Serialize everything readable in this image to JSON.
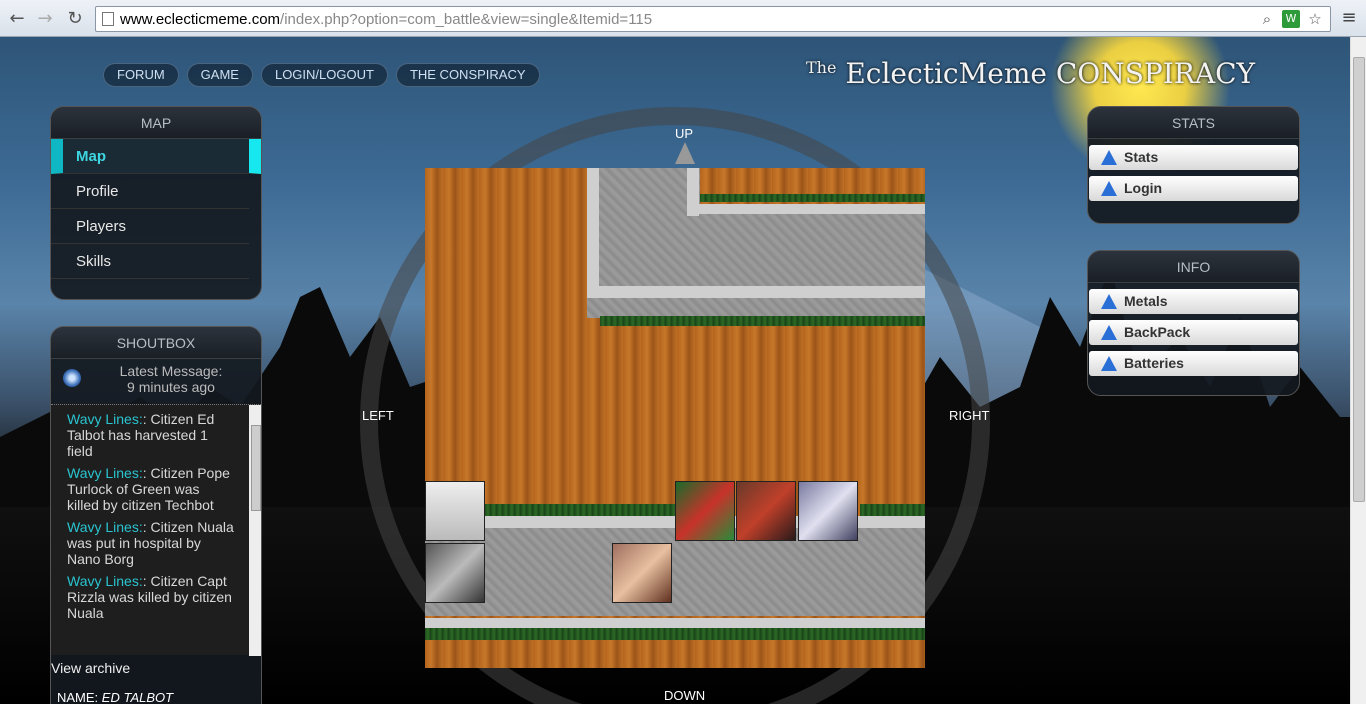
{
  "browser": {
    "url_host": "www.eclecticmeme.com",
    "url_path": "/index.php?option=com_battle&view=single&Itemid=115"
  },
  "topnav": [
    "FORUM",
    "GAME",
    "LOGIN/LOGOUT",
    "THE CONSPIRACY"
  ],
  "logo": {
    "the": "The",
    "name": "EclecticMeme CONSPIRACY"
  },
  "map_panel": {
    "title": "MAP",
    "items": [
      "Map",
      "Profile",
      "Players",
      "Skills"
    ]
  },
  "shoutbox": {
    "title": "SHOUTBOX",
    "latest_label": "Latest Message:",
    "latest_time": "9 minutes ago",
    "messages": [
      {
        "who": "Wavy Lines:",
        "text": ": Citizen Ed Talbot has harvested 1 field"
      },
      {
        "who": "Wavy Lines:",
        "text": ": Citizen Pope Turlock of Green was killed by citizen Techbot"
      },
      {
        "who": "Wavy Lines:",
        "text": ": Citizen Nuala was put in hospital by Nano Borg"
      },
      {
        "who": "Wavy Lines:",
        "text": ": Citizen Capt Rizzla was killed by citizen Nuala"
      }
    ],
    "archive": "View archive",
    "name_label": "NAME:",
    "name_value": "ED TALBOT"
  },
  "stats_panel": {
    "title": "STATS",
    "buttons": [
      "Stats",
      "Login"
    ]
  },
  "info_panel": {
    "title": "INFO",
    "buttons": [
      "Metals",
      "BackPack",
      "Batteries"
    ]
  },
  "directions": {
    "up": "UP",
    "down": "DOWN",
    "left": "LEFT",
    "right": "RIGHT"
  },
  "colors": {
    "accent": "#29c4d0",
    "board": "#b5651d"
  }
}
